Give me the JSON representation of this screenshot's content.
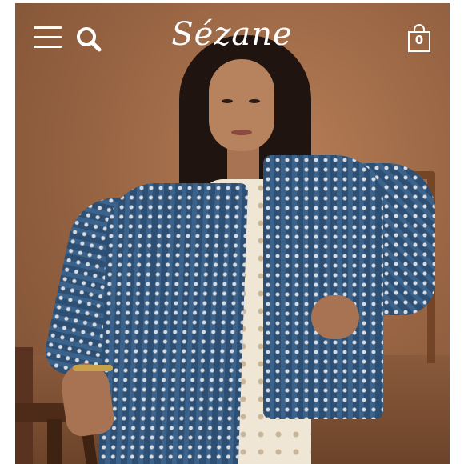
{
  "header": {
    "brand_name": "Sézane",
    "cart_count": "0",
    "icons": [
      "menu-icon",
      "search-icon",
      "shopping-bag-icon"
    ]
  },
  "hero": {
    "image_description_icon": "product-photo",
    "colors": {
      "background": "#9a6644",
      "jacket": "#2c4f73",
      "dress": "#efe6d6"
    }
  }
}
